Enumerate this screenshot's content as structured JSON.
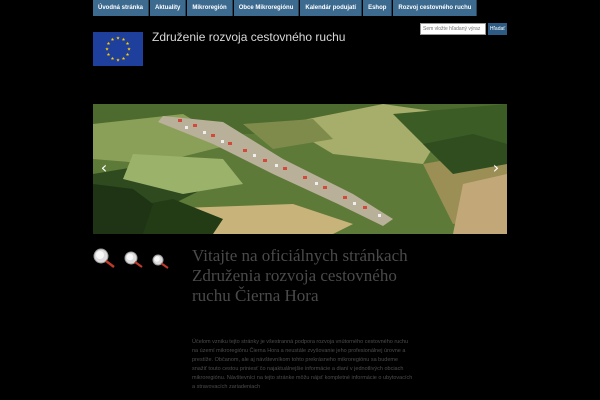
{
  "nav": {
    "items": [
      {
        "label": "Úvodná stránka"
      },
      {
        "label": "Aktuality"
      },
      {
        "label": "Mikroregión"
      },
      {
        "label": "Obce Mikroregiónu"
      },
      {
        "label": "Kalendár podujatí"
      },
      {
        "label": "Eshop"
      },
      {
        "label": "Rozvoj cestovného ruchu"
      }
    ]
  },
  "header": {
    "title": "Združenie rozvoja cestovného ruchu",
    "logo_icon": "eu-flag-icon"
  },
  "search": {
    "placeholder": "Sem vložte hľadaný výraz",
    "button_label": "Hľadať"
  },
  "slider": {
    "prev_icon": "chevron-left-icon",
    "next_icon": "chevron-right-icon"
  },
  "main": {
    "welcome_heading": "Vitajte na oficiálnych stránkach Združenia rozvoja cestovného ruchu Čierna Hora",
    "intro_text": "Účelom vzniku tejto stránky je všestranná podpora rozvoja vnútorného cestovného ruchu na území mikroregiónu Čierna Hora a neustále zvyšovanie jeho profesionálnej úrovne a prestíže. Občanom, ale aj návštevníkom tohto prekrásneho mikroregiónu sa budeme snažiť touto cestou priniesť čo najaktuálnejšie informácie a dianí v jednotlivých obciach mikroregiónu. Návštevníci na tejto stránke môžu nájsť kompletné informácie o ubytovacích a stravovacích zariadeniach",
    "zoom_icons": [
      "zoom-large-icon",
      "zoom-medium-icon",
      "zoom-small-icon"
    ]
  },
  "colors": {
    "background": "#000000",
    "nav_bg": "#3d6a8f",
    "heading_text": "#4a4a4a",
    "eu_blue": "#1f3f9c",
    "eu_star": "#ffcc00"
  }
}
